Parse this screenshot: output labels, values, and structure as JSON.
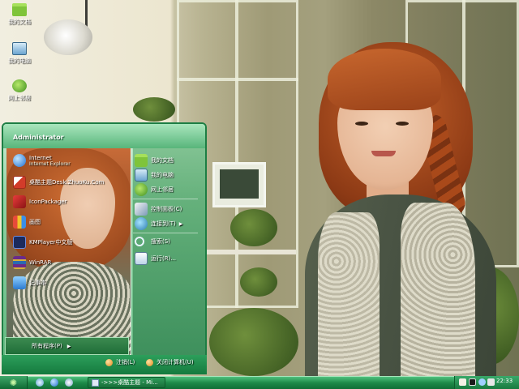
{
  "desktop_icons": [
    {
      "label": "我的文档",
      "icon": "folder-icon"
    },
    {
      "label": "我的电脑",
      "icon": "computer-icon"
    },
    {
      "label": "网上邻居",
      "icon": "network-icon"
    }
  ],
  "start_menu": {
    "user_name": "Administrator",
    "pinned": [
      {
        "label": "Internet",
        "sub": "Internet Explorer",
        "icon": "internet-explorer-icon"
      },
      {
        "label": "桌酷主题Desk.ZhuoKu.Com",
        "icon": "zhuoku-icon"
      },
      {
        "label": "IconPackager",
        "icon": "iconpackager-icon"
      },
      {
        "label": "画图",
        "icon": "paint-icon"
      },
      {
        "label": "KMPlayer中文版",
        "icon": "kmplayer-icon"
      },
      {
        "label": "WinRAR",
        "icon": "winrar-icon"
      },
      {
        "label": "记事本",
        "icon": "notepad-icon"
      }
    ],
    "places": [
      {
        "label": "我的文档",
        "icon": "folder-icon"
      },
      {
        "label": "我的电脑",
        "icon": "computer-icon"
      },
      {
        "label": "网上邻居",
        "icon": "network-icon"
      },
      {
        "label": "控制面板(C)",
        "icon": "control-panel-icon"
      },
      {
        "label": "连接到(T)",
        "icon": "connect-icon",
        "has_submenu": true
      },
      {
        "label": "搜索(S)",
        "icon": "search-icon"
      },
      {
        "label": "运行(R)...",
        "icon": "run-icon"
      }
    ],
    "all_programs": "所有程序(P)",
    "logoff": "注销(L)",
    "shutdown": "关闭计算机(U)"
  },
  "taskbar": {
    "task_button": "->>>桌酷主题 - Mi...",
    "clock": "22:33"
  },
  "colors": {
    "accent": "#1d8a48",
    "menu_green": "#5fb77e"
  }
}
